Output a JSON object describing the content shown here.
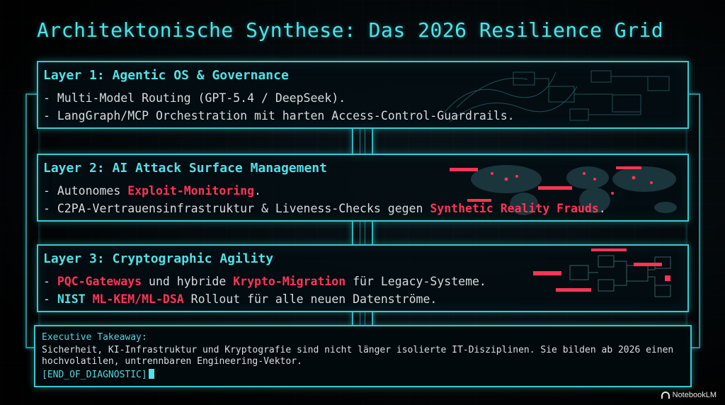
{
  "title": "Architektonische Synthese: Das 2026 Resilience Grid",
  "layers": [
    {
      "title": "Layer 1: Agentic OS & Governance",
      "lines": [
        {
          "text": "- Multi-Model Routing (GPT-5.4 / DeepSeek)."
        },
        {
          "text": "- LangGraph/MCP Orchestration mit harten Access-Control-Guardrails."
        }
      ]
    },
    {
      "title": "Layer 2: AI Attack Surface Management",
      "lines": [
        {
          "pre": "- Autonomes ",
          "hl": "Exploit-Monitoring",
          "post": "."
        },
        {
          "pre": "- C2PA-Vertrauensinfrastruktur & Liveness-Checks gegen ",
          "hl": "Synthetic Reality Frauds",
          "post": "."
        }
      ]
    },
    {
      "title": "Layer 3: Cryptographic Agility",
      "lines": [
        {
          "pre": "- ",
          "hl": "PQC-Gateways",
          "mid": " und hybride ",
          "hl2": "Krypto-Migration",
          "post": " für Legacy-Systeme."
        },
        {
          "pre": "- ",
          "cy": "NIST",
          "mid": " ",
          "hl": "ML-KEM/ML-DSA",
          "post": " Rollout für alle neuen Datenströme."
        }
      ]
    }
  ],
  "takeaway": {
    "heading": "Executive Takeaway:",
    "body": "Sicherheit, KI-Infrastruktur und Kryptografie sind nicht länger isolierte IT-Disziplinen. Sie bilden ab 2026 einen hochvolatilen, untrennbaren Engineering-Vektor.",
    "end_marker": "[END_OF_DIAGNOSTIC]"
  },
  "watermark": "NotebookLM",
  "colors": {
    "accent": "#3bc9cf",
    "highlight": "#ff3456",
    "text": "#d6dadd"
  }
}
